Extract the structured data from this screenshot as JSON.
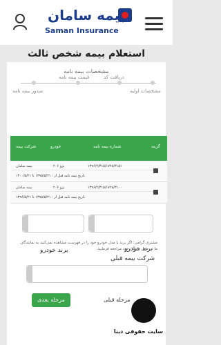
{
  "header": {
    "logo_text_fa": "بیمه سامان",
    "logo_text_en": "Saman Insurance"
  },
  "page_title": "استعلام بیمه شخص ثالث",
  "steps": {
    "title": "مشخصات بیمه نامه",
    "items": [
      "دریافت کد",
      "قیمت بیمه نامه",
      "مشخصات اولیه",
      "صدور بیمه نامه"
    ]
  },
  "table": {
    "headers": {
      "choose": "گزینه",
      "policy_number": "شماره بیمه نامه",
      "vehicle": "خودرو",
      "company": "شرکت بیمه"
    },
    "rows": [
      {
        "policy_number": "۱۳۹۶/۲/۳۱۵/۱۷۲۸/۳۱۵۱",
        "vehicle": "پژو ۲۰۶",
        "company": "بیمه سامان",
        "date_text": "تاریخ بیمه نامه قبل از : ۱۳۹۵/۵/۲۱ تا ۱۴۰۰/۵/۲۱"
      },
      {
        "policy_number": "۱۳۹۶/۲/۳۱۵/۱۷۲۸/۳۱۰۰",
        "vehicle": "پژو ۲۰۶",
        "company": "بیمه سامان",
        "date_text": "تاریخ بیمه نامه قبل از : ۱۳۹۵/۵/۲۱ تا ۱۳۹۶/۵/۲۱"
      }
    ]
  },
  "vehicle_brand": {
    "label_right": "برند خودرو",
    "label_left": "برند خودرو"
  },
  "notice": "مشتری گرامی؛ اگر برند یا مدل خودرو خود را در فهرست مشاهده نمی‌کنید به نمایندگان ما در محل زندگی خود مراجعه فرمایید.",
  "previous_insurer": {
    "label": "شرکت بیمه قبلی"
  },
  "buttons": {
    "next": "مرحله بعدی",
    "prev": "مرحله قبلی"
  },
  "watermark": {
    "text": "سایت حقوقی دینا"
  }
}
